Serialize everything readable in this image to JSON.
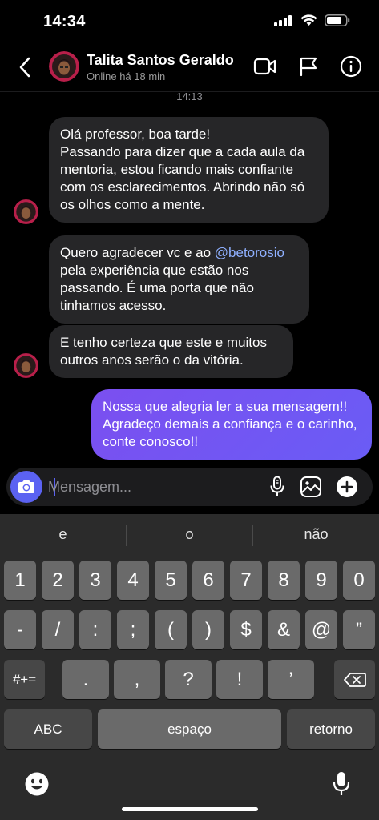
{
  "status_bar": {
    "time": "14:34"
  },
  "header": {
    "back_icon": "chevron-left-icon",
    "contact_name": "Talita Santos Geraldo",
    "contact_status": "Online há 18 min",
    "icons": [
      "video-camera-icon",
      "flag-icon",
      "info-icon"
    ]
  },
  "conversation": {
    "timestamp": "14:13",
    "messages": [
      {
        "from": "them",
        "text": "Olá professor, boa tarde!\nPassando para dizer que a cada aula da mentoria, estou ficando mais confiante com os esclarecimentos.  Abrindo não só os olhos como a mente."
      },
      {
        "from": "them",
        "text_before": "Quero agradecer vc e ao ",
        "mention": "@betorosio",
        "text_after": " pela experiência que estão nos passando. É uma porta que não tinhamos acesso."
      },
      {
        "from": "them",
        "text": "E tenho certeza que este e muitos outros anos serão o da vitória."
      },
      {
        "from": "me",
        "text": "Nossa que alegria ler a sua mensagem!! Agradeço demais a confiança e o carinho, conte conosco!!"
      }
    ]
  },
  "composer": {
    "placeholder": "Mensagem...",
    "icons": [
      "camera-icon",
      "microphone-icon",
      "image-gallery-icon",
      "plus-icon"
    ]
  },
  "keyboard": {
    "suggestions": [
      "e",
      "o",
      "não"
    ],
    "row1": [
      "1",
      "2",
      "3",
      "4",
      "5",
      "6",
      "7",
      "8",
      "9",
      "0"
    ],
    "row2": [
      "-",
      "/",
      ":",
      ";",
      "(",
      ")",
      "$",
      "&",
      "@",
      "”"
    ],
    "row3_left": "#+=",
    "row3": [
      ".",
      ",",
      "?",
      "!",
      "’"
    ],
    "abc_label": "ABC",
    "space_label": "espaço",
    "return_label": "retorno",
    "icons": [
      "backspace-icon",
      "emoji-icon",
      "dictation-microphone-icon"
    ]
  },
  "colors": {
    "background": "#000000",
    "incoming_bubble": "#262628",
    "outgoing_bubble": "#7455f2",
    "accent": "#5b62f2",
    "mention": "#8fb0ff"
  }
}
